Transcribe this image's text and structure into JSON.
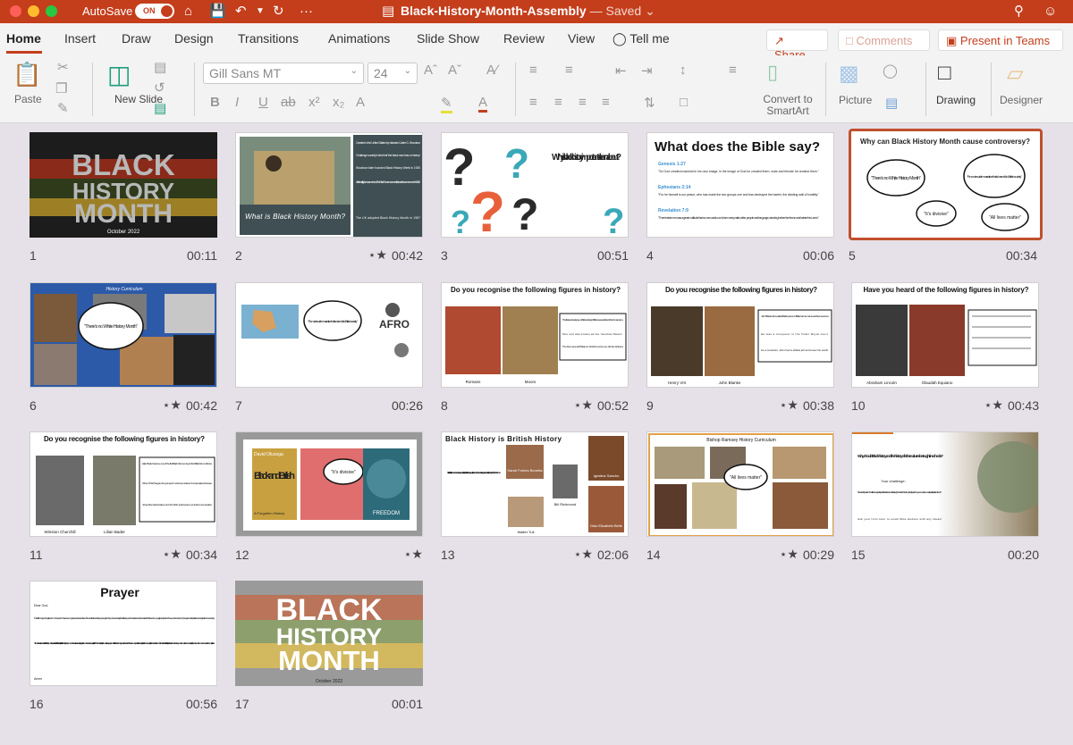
{
  "titlebar": {
    "autosave_label": "AutoSave",
    "autosave_state": "ON",
    "document_name": "Black-History-Month-Assembly",
    "saved_status": "— Saved"
  },
  "tabs": [
    "Home",
    "Insert",
    "Draw",
    "Design",
    "Transitions",
    "Animations",
    "Slide Show",
    "Review",
    "View"
  ],
  "tell_me": "Tell me",
  "share_label": "Share",
  "comments_label": "Comments",
  "present_teams_label": "Present in Teams",
  "ribbon": {
    "paste": "Paste",
    "new_slide": "New Slide",
    "font_name": "Gill Sans MT",
    "font_size": "24",
    "convert_smartart": "Convert to SmartArt",
    "picture": "Picture",
    "drawing": "Drawing",
    "designer": "Designer"
  },
  "slides": [
    {
      "num": "1",
      "time": "00:11",
      "anim": false
    },
    {
      "num": "2",
      "time": "00:42",
      "anim": true
    },
    {
      "num": "3",
      "time": "00:51",
      "anim": false
    },
    {
      "num": "4",
      "time": "00:06",
      "anim": false
    },
    {
      "num": "5",
      "time": "00:34",
      "anim": false,
      "selected": true
    },
    {
      "num": "6",
      "time": "00:42",
      "anim": true
    },
    {
      "num": "7",
      "time": "00:26",
      "anim": false
    },
    {
      "num": "8",
      "time": "00:52",
      "anim": true
    },
    {
      "num": "9",
      "time": "00:38",
      "anim": true
    },
    {
      "num": "10",
      "time": "00:43",
      "anim": true
    },
    {
      "num": "11",
      "time": "00:34",
      "anim": true
    },
    {
      "num": "12",
      "time": "",
      "anim": true
    },
    {
      "num": "13",
      "time": "02:06",
      "anim": true
    },
    {
      "num": "14",
      "time": "00:29",
      "anim": true
    },
    {
      "num": "15",
      "time": "00:20",
      "anim": false
    },
    {
      "num": "16",
      "time": "00:56",
      "anim": false
    },
    {
      "num": "17",
      "time": "00:01",
      "anim": false
    }
  ],
  "content": {
    "bhm_line1": "BLACK",
    "bhm_line2": "HISTORY",
    "bhm_line3": "MONTH",
    "bhm_date": "October 2022",
    "s2_title": "What is Black History Month?",
    "s2_b1": "Created in the United States by historian Carter G. Woodson",
    "s2_b2": "Challenge society's idea that 'the black man has no history'",
    "s2_b3": "Woodson later founded Black History Week in 1926",
    "s2_b4": "After the civil rights movement and The Black Power movement, this week became a month in 1969",
    "s2_b5": "The UK adopted Black History Month in 1987",
    "s3_title": "Why is black history important to learn about?",
    "s4_title": "What does the Bible say?",
    "s4_ref1": "Genesis 1:27",
    "s4_q1": "\"So God created mankind in his own image, in the image of God he created them; male and female he created them.\"",
    "s4_ref2": "Ephesians 2:14",
    "s4_q2": "\"For he himself is our peace, who has made the two groups one and has destroyed the barrier, the dividing wall of hostility.\"",
    "s4_ref3": "Revelation 7:9",
    "s4_q3": "\"There before me was a great multitude that no one could count, from every nation, tribe, people and language, standing before the throne and before the Lamb.\"",
    "s5_title": "Why can Black History Month cause controversy?",
    "q_no_white": "\"There's no White History Month\"",
    "q_promotes": "\"Promotes victim narrative that is harmful to British society\"",
    "q_divisive": "\"It's divisive\"",
    "q_all_lives": "\"All lives matter\"",
    "s6_title": "History Curriculum",
    "s7_afro": "AFRO",
    "s8_title": "Do you recognise the following figures in history?",
    "s8_cap1": "Romans",
    "s8_cap2": "Moors",
    "s8_b1": "The first recorded group of Africans living in Britain were soldiers in the Roman army.",
    "s8_b2": "One unit was known as the 'Aurelian Moors'.",
    "s8_b3": "The Romans left Britain in 410AD and so too did the Africans",
    "s9_cap1": "Henry VIII",
    "s9_cap2": "John Blanke",
    "s9_b1": "John Blanke is the earliest Black person in Britain whose name and face we know.",
    "s9_b2": "He was a trumpeter in the Tudor Royal court.",
    "s9_b3": "As a musician, John had a skilled job and knew his worth.",
    "s10_title": "Have you heard of the following figures in history?",
    "s10_cap1": "Abraham Lincoln",
    "s10_cap2": "Olaudah Equiano",
    "s11_title": "Do you recognise the following figures in history?",
    "s11_cap1": "Winston Churchill",
    "s11_cap2": "Lilian Bader",
    "s11_b1": "Lilian Bader became one of the first Black Women to join the British Armed forces",
    "s11_b2": "When WW2 began she got a job in a forces canteen but was asked to leave",
    "s11_b3": "Joined the West Indies unit in the RAF and became an instrument repairer",
    "s12_book1": "Black and British",
    "s12_author": "David Olusoga",
    "s12_sub": "A Forgotten History",
    "s12_freedom": "FREEDOM",
    "s13_title": "Black History is British History",
    "s13_quote": "\"History isn't a sold out of facts...It's very much about what questions you ask of the past. If you ask different questions you get different answers. People weren't asking questions about diversity. Now they are.\" – Miranda Kaufmann",
    "s13_n1": "Sarah Forbes Bonetta",
    "s13_n2": "Ignatius Sancho",
    "s13_n3": "Bill Richmond",
    "s13_n4": "Walter Tull",
    "s13_n5": "Dido Elizabeth Belle",
    "s14_title": "Bishop Ramsey History Curriculum",
    "s15_title": "Why should Black history and the history of other cultures be taught in schools?",
    "s15_chal": "Your challenge:",
    "s15_body": "Discuss with your form the different ways history of other cultures could be taught in schools. What important figures from your own culture would you like to learn about?",
    "s15_foot": "Ask your form tutor to email Miss Hudson with any ideas!",
    "s16_title": "Prayer",
    "s16_dear": "Dear God,",
    "s16_p1": "Merciful God, you bring freedom to those who have been oppressed and enslaved. You are the liberator of your people. May we be a society that reflects your characters and advocates for the freedom, equality and justice of those pushed down by the systematic injustices and prejudices in our society.",
    "s16_p2": "This month in our nations character is Black History month. Help us to realise that Black History is all our histories. May the day come when these stories are so widely taught that no month need be separately divided. We know this day will not come until we as a people make different choices. We pray now for those choices. There are so many beautiful stories needing to be told. And we need to get the chance to hear them. Widen our vision so that the history that is shared this month and every month comes to be known as our history too. We are most human when we see the humanity in others.",
    "s16_amen": "Amen"
  }
}
